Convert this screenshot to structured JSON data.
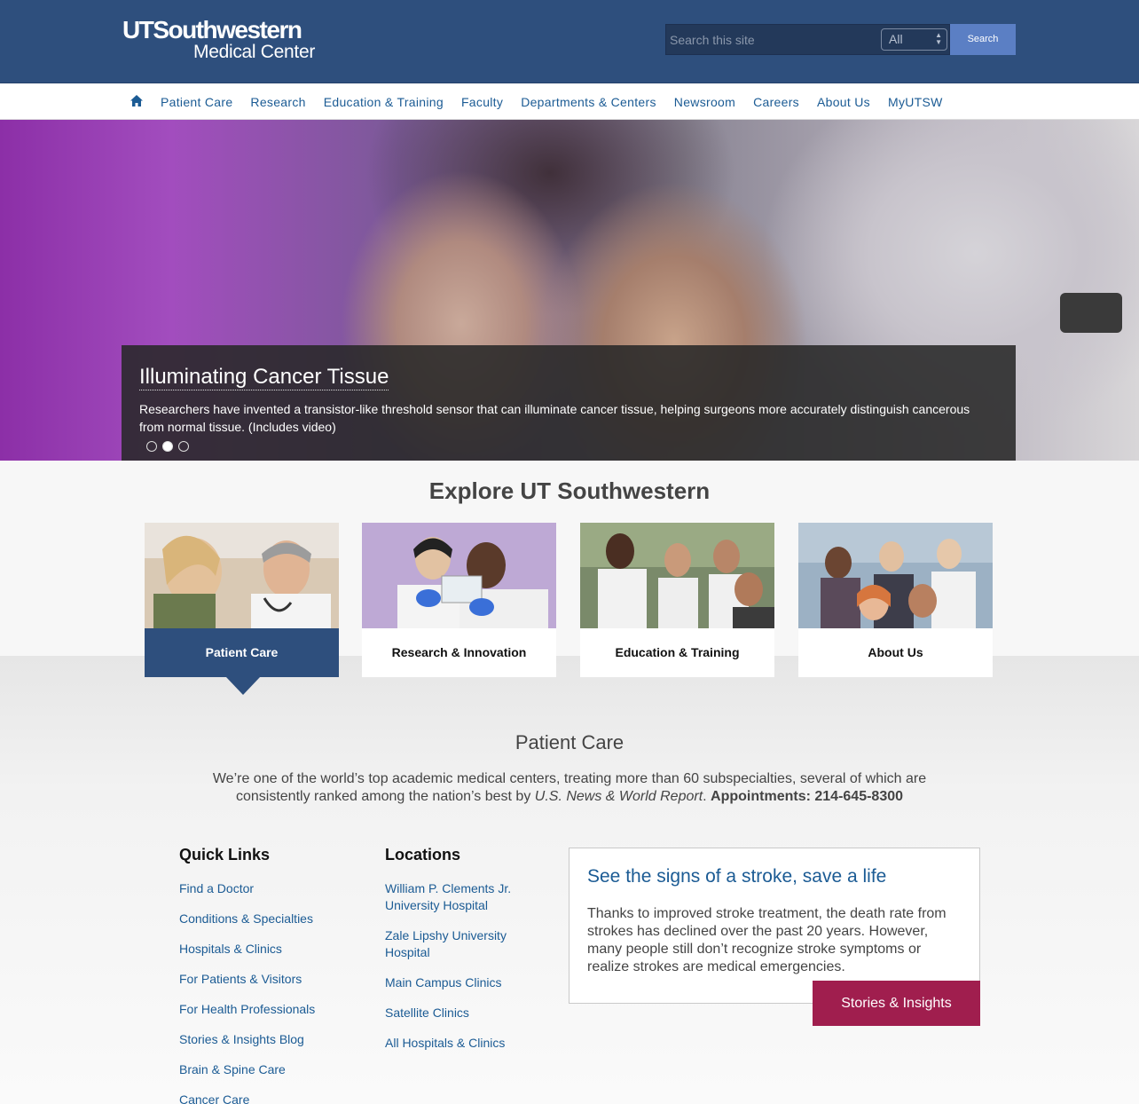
{
  "header": {
    "logo_line1": "UTSouthwestern",
    "logo_line2": "Medical Center",
    "search_placeholder": "Search this site",
    "search_scope": "All",
    "search_button": "Search"
  },
  "nav": {
    "home_icon": "home-icon",
    "items": [
      "Patient Care",
      "Research",
      "Education & Training",
      "Faculty",
      "Departments & Centers",
      "Newsroom",
      "Careers",
      "About Us",
      "MyUTSW"
    ]
  },
  "hero": {
    "title": "Illuminating Cancer Tissue",
    "text": "Researchers have invented a transistor-like threshold sensor that can illuminate cancer tissue, helping surgeons more accurately distinguish cancerous from normal tissue. (Includes video)",
    "slides_total": 3,
    "active_slide": 2
  },
  "explore": {
    "title": "Explore UT Southwestern",
    "cards": [
      {
        "label": "Patient Care",
        "active": true
      },
      {
        "label": "Research & Innovation",
        "active": false
      },
      {
        "label": "Education & Training",
        "active": false
      },
      {
        "label": "About Us",
        "active": false
      }
    ]
  },
  "patient_care": {
    "title": "Patient Care",
    "desc_part1": "We’re one of the world’s top academic medical centers, treating more than 60 subspecialties, several of which are consistently ranked among the nation’s best by ",
    "desc_italic": "U.S. News & World Report",
    "desc_part2": ". ",
    "desc_bold": "Appointments: 214-645-8300"
  },
  "quick_links": {
    "heading": "Quick Links",
    "items": [
      "Find a Doctor",
      "Conditions & Specialties",
      "Hospitals & Clinics",
      "For Patients & Visitors",
      "For Health Professionals",
      "Stories & Insights Blog",
      "Brain & Spine Care",
      "Cancer Care"
    ]
  },
  "locations": {
    "heading": "Locations",
    "items": [
      "William P. Clements Jr. University Hospital",
      "Zale Lipshy University Hospital",
      "Main Campus Clinics",
      "Satellite Clinics",
      "All Hospitals & Clinics"
    ]
  },
  "feature": {
    "title": "See the signs of a stroke, save a life",
    "text": "Thanks to improved stroke treatment, the death rate from strokes has declined over the past 20 years. However, many people still don’t recognize stroke symptoms or realize strokes are medical emergencies.",
    "button": "Stories & Insights"
  },
  "colors": {
    "brand_blue": "#2e4f7d",
    "link_blue": "#1b5b94",
    "search_button": "#5b7fc4",
    "feature_button": "#a01e4e"
  }
}
